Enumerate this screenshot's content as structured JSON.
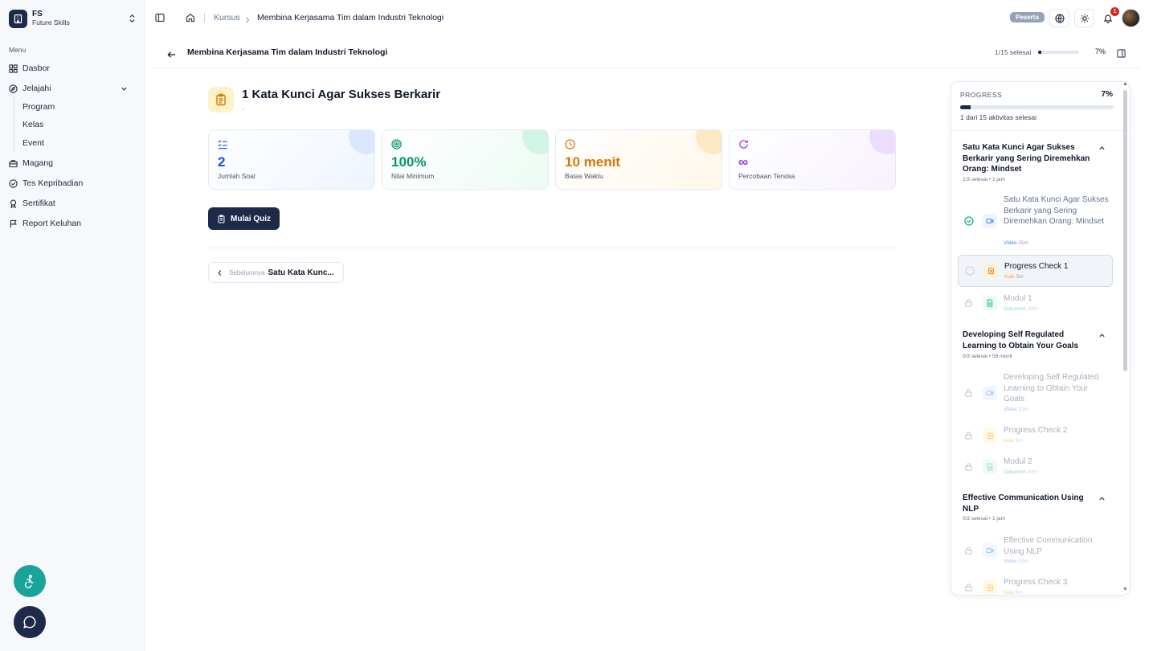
{
  "brand": {
    "abbr": "FS",
    "name": "Future Skills"
  },
  "sidebar": {
    "menu_title": "Menu",
    "items": [
      {
        "label": "Dasbor",
        "icon": "grid-icon"
      },
      {
        "label": "Jelajahi",
        "icon": "compass-icon"
      },
      {
        "label": "Magang",
        "icon": "briefcase-icon"
      },
      {
        "label": "Tes Kepribadian",
        "icon": "check-circle-icon"
      },
      {
        "label": "Sertifikat",
        "icon": "award-icon"
      },
      {
        "label": "Report Keluhan",
        "icon": "flag-icon"
      }
    ],
    "sub_items": [
      "Program",
      "Kelas",
      "Event"
    ]
  },
  "topbar": {
    "breadcrumb_parent": "Kursus",
    "breadcrumb_current": "Membina Kerjasama Tim dalam Industri Teknologi",
    "role_badge": "Peserta",
    "notification_count": "1"
  },
  "course": {
    "title": "Membina Kerjasama Tim dalam Industri Teknologi",
    "progress_text": "1/15 selesai",
    "progress_pct_label": "7%",
    "progress_fraction": 0.07
  },
  "quiz": {
    "title": "1 Kata Kunci Agar Sukses Berkarir",
    "subtitle": "-",
    "stats": [
      {
        "value": "2",
        "label": "Jumlah Soal",
        "color": "#1d4ed8",
        "icon": "list-check-icon"
      },
      {
        "value": "100%",
        "label": "Nilai Minimum",
        "color": "#059669",
        "icon": "target-icon"
      },
      {
        "value": "10 menit",
        "label": "Batas Waktu",
        "color": "#d97706",
        "icon": "clock-icon"
      },
      {
        "value": "∞",
        "label": "Percobaan Tersisa",
        "color": "#9333ea",
        "icon": "refresh-icon"
      }
    ],
    "start_label": "Mulai Quiz",
    "prev_label": "Sebelumnya",
    "prev_title": "Satu Kata Kunc..."
  },
  "panel": {
    "label": "PROGRESS",
    "pct_label": "7%",
    "fraction": 0.07,
    "sub": "1 dari 15 aktivitas selesai",
    "sections": [
      {
        "title": "Satu Kata Kunci Agar Sukses Berkarir yang Sering Diremehkan Orang: Mindset",
        "meta": "1/3 selesai  • 1 jam",
        "items": [
          {
            "title": "Satu Kata Kunci Agar Sukses Berkarir yang Sering Diremehkan Orang: Mindset",
            "type": "Video",
            "dur": "25m"
          },
          {
            "title": "Progress Check 1",
            "type": "Kuis",
            "dur": "5m"
          },
          {
            "title": "Modul 1",
            "type": "Dokumen",
            "dur": "30m"
          }
        ]
      },
      {
        "title": "Developing Self Regulated Learning to Obtain Your Goals",
        "meta": "0/3 selesai  • 58 menit",
        "items": [
          {
            "title": "Developing Self Regulated Learning to Obtain Your Goals",
            "type": "Video",
            "dur": "23m"
          },
          {
            "title": "Progress Check 2",
            "type": "Kuis",
            "dur": "5m"
          },
          {
            "title": "Modul 2",
            "type": "Dokumen",
            "dur": "30m"
          }
        ]
      },
      {
        "title": "Effective Communication Using NLP",
        "meta": "0/3 selesai  • 1 jam",
        "items": [
          {
            "title": "Effective Communication Using NLP",
            "type": "Video",
            "dur": "25m"
          },
          {
            "title": "Progress Check 3",
            "type": "Kuis",
            "dur": "5m"
          }
        ]
      }
    ]
  },
  "colors": {
    "navy": "#1e2a4a",
    "teal": "#1aa39a",
    "video": "#3b82f6",
    "quiz": "#f59e0b",
    "doc": "#10b981"
  }
}
